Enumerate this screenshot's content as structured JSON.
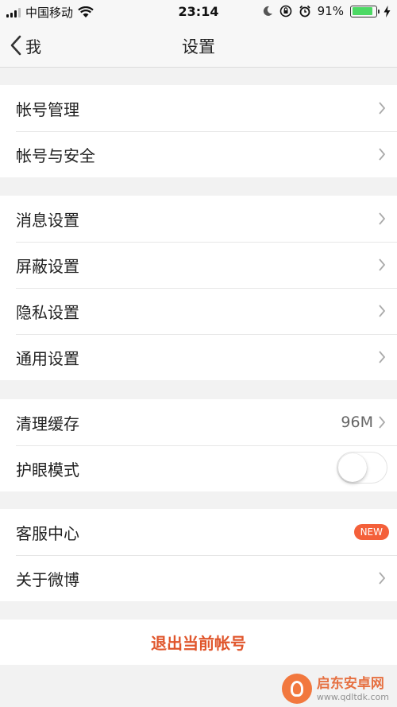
{
  "status_bar": {
    "carrier": "中国移动",
    "time": "23:14",
    "battery_percent": "91%",
    "battery_level": 0.91,
    "icons": [
      "signal-icon",
      "wifi-icon",
      "moon-icon",
      "rotation-lock-icon",
      "alarm-icon",
      "battery-icon",
      "charging-icon"
    ]
  },
  "nav": {
    "back_label": "我",
    "title": "设置"
  },
  "groups": {
    "account": [
      {
        "label": "帐号管理"
      },
      {
        "label": "帐号与安全"
      }
    ],
    "settings": [
      {
        "label": "消息设置"
      },
      {
        "label": "屏蔽设置"
      },
      {
        "label": "隐私设置"
      },
      {
        "label": "通用设置"
      }
    ],
    "misc": {
      "cache_label": "清理缓存",
      "cache_value": "96M",
      "eye_mode_label": "护眼模式",
      "eye_mode_on": false
    },
    "support": {
      "service_label": "客服中心",
      "service_badge": "NEW",
      "about_label": "关于微博"
    }
  },
  "logout_label": "退出当前帐号",
  "watermark": {
    "name": "启东安卓网",
    "url": "www.qdltdk.com"
  },
  "colors": {
    "accent": "#e0562c",
    "badge": "#f4603a",
    "background": "#f2f2f2",
    "battery": "#4cd964"
  }
}
